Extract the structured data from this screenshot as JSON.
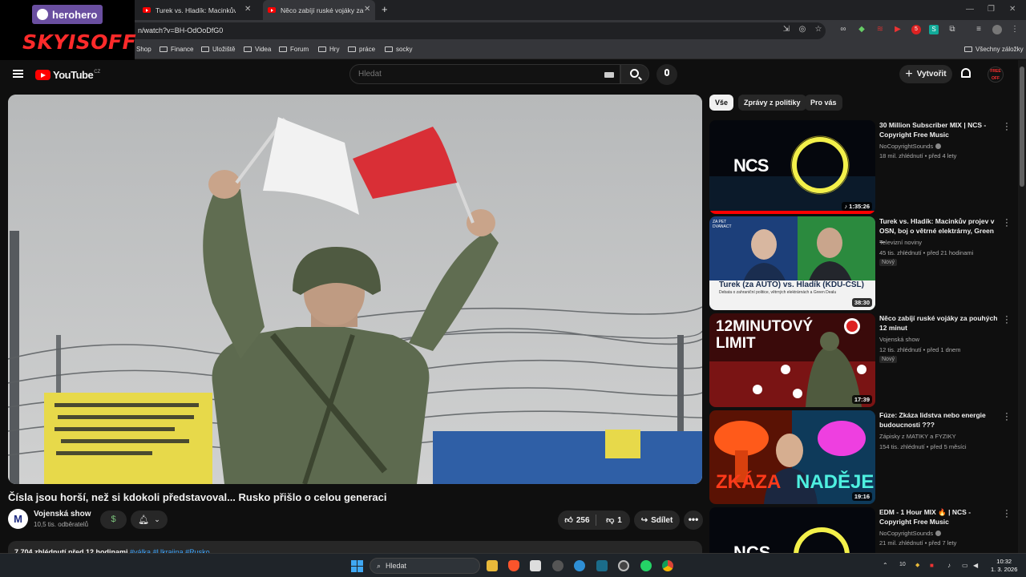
{
  "browser": {
    "tabs": [
      {
        "title": "Turek vs. Hladík: Macinkův projev v OSN"
      },
      {
        "title": "Něco zabíjí ruské vojáky za pouhých 12 minut"
      }
    ],
    "new_tab": "+",
    "url": "n/watch?v=BH-OdOoDfG0",
    "bookmarks": [
      "Shop",
      "Finance",
      "Uložiště",
      "Videa",
      "Forum",
      "Hry",
      "práce",
      "socky"
    ],
    "all_bookmarks": "Všechny záložky"
  },
  "overlay": {
    "brand": "herohero",
    "name": "SKYISOFF"
  },
  "youtube": {
    "logo_text": "YouTube",
    "logo_country": "CZ",
    "search_placeholder": "Hledat",
    "create_label": "Vytvořit",
    "avatar_text": "FREE OFF"
  },
  "video": {
    "title": "Čísla jsou horší, než si kdokoli představoval... Rusko přišlo o celou generaci",
    "channel": "Vojenská show",
    "channel_initial": "M",
    "subscribers": "10,5 tis. odběratelů",
    "join_symbol": "$",
    "likes": "256",
    "dislikes": "1",
    "share_label": "Sdílet",
    "more": "•••",
    "views_time": "7 704 zhlédnutí  před 12 hodinami",
    "tags": "#válka #Ukrajina #Rusko"
  },
  "chips": [
    {
      "label": "Vše",
      "active": true
    },
    {
      "label": "Zprávy z politiky",
      "active": false
    },
    {
      "label": "Pro vás",
      "active": false
    }
  ],
  "recommendations": [
    {
      "title": "30 Million Subscriber MIX | NCS - Copyright Free Music",
      "channel": "NoCopyrightSounds",
      "meta": "18 mil. zhlédnutí • před 4 lety",
      "duration": "♪ 1:35:26",
      "badge": "",
      "thumb_text": "NCS"
    },
    {
      "title": "Turek vs. Hladík: Macinkův projev v OSN, boj o větrné elektrárny, Green ...",
      "channel": "Televizní noviny",
      "meta": "45 tis. zhlédnutí • před 21 hodinami",
      "duration": "38:30",
      "badge": "Nový",
      "thumb_text": "Turek (za AUTO) vs. Hladík (KDU-ČSL)",
      "thumb_sub": "Debata o zahraniční politice, větrných elektrárnách a Green Dealu",
      "thumb_corner": "ZA PET DVANACT"
    },
    {
      "title": "Něco zabíjí ruské vojáky za pouhých 12 minut",
      "channel": "Vojenská show",
      "meta": "12 tis. zhlédnutí • před 1 dnem",
      "duration": "17:39",
      "badge": "Nový",
      "thumb_text": "12MINUTOVÝ LIMIT"
    },
    {
      "title": "Fúze: Zkáza lidstva nebo energie budoucnosti ???",
      "channel": "Zápisky z MATIKY a FYZIKY",
      "meta": "154 tis. zhlédnutí • před 5 měsíci",
      "duration": "19:16",
      "badge": "",
      "thumb_text_left": "ZKÁZA",
      "thumb_text_right": "NADĚJE"
    },
    {
      "title": "EDM - 1 Hour MIX 🔥 | NCS - Copyright Free Music",
      "channel": "NoCopyrightSounds",
      "meta": "21 mil. zhlédnutí • před 7 lety",
      "duration": "",
      "badge": "",
      "thumb_text": "NCS"
    }
  ],
  "taskbar": {
    "search": "Hledat",
    "time": "10:32",
    "date": "1. 3. 2026",
    "tray_num": "10"
  },
  "colors": {
    "yt_red": "#ff0000",
    "link_blue": "#3ea6ff",
    "overlay_red": "#ff2a2a",
    "herohero_purple": "#6a4fa0"
  }
}
